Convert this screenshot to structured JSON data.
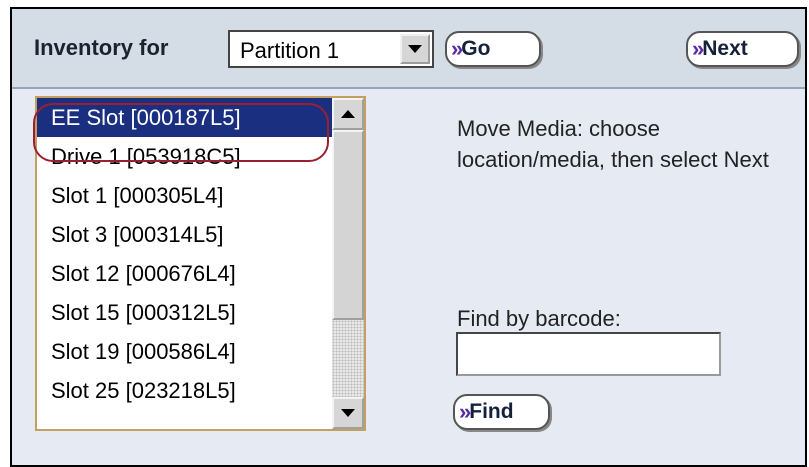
{
  "header": {
    "inventory_label": "Inventory for",
    "partition_select": {
      "selected": "Partition 1"
    },
    "go_label": "Go",
    "next_label": "Next"
  },
  "media_list": {
    "items": [
      "EE Slot [000187L5]",
      "Drive 1 [053918C5]",
      "Slot 1 [000305L4]",
      "Slot 3 [000314L5]",
      "Slot 12 [000676L4]",
      "Slot 15 [000312L5]",
      "Slot 19 [000586L4]",
      "Slot 25 [023218L5]"
    ],
    "selected_index": 0
  },
  "instructions": "Move Media: choose location/media, then select Next",
  "find": {
    "label": "Find by barcode:",
    "input_value": "",
    "button_label": "Find"
  },
  "colors": {
    "selection_bg": "#1b2f80",
    "button_chevron": "#5b2aa6",
    "highlight_ring": "#9a2030",
    "listbox_border": "#c4a060"
  }
}
